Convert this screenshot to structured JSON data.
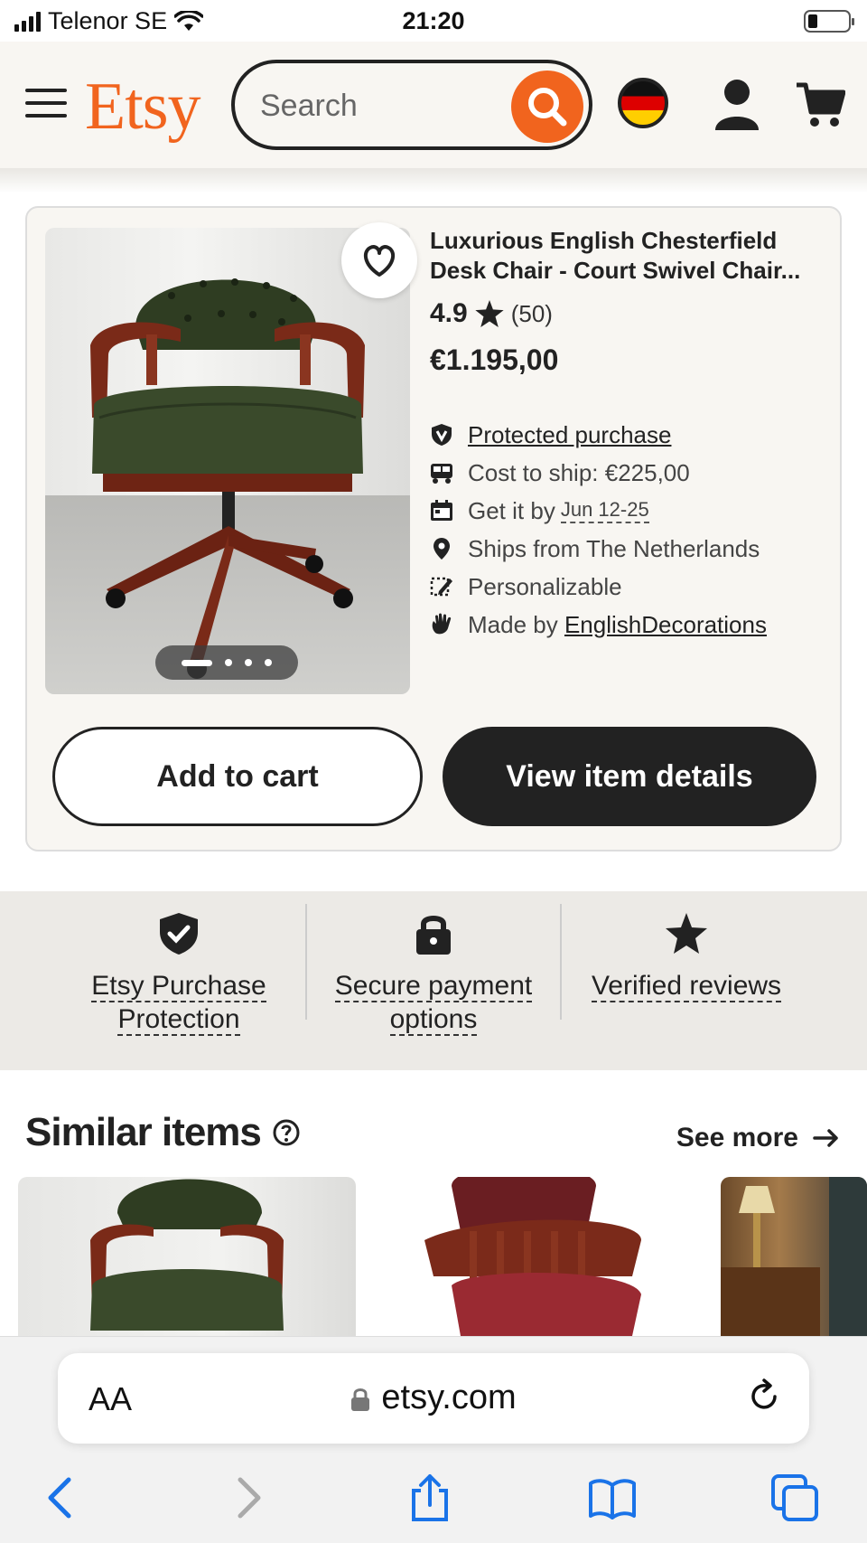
{
  "status_bar": {
    "carrier": "Telenor SE",
    "time": "21:20"
  },
  "header": {
    "logo": "Etsy",
    "search_placeholder": "Search"
  },
  "product": {
    "title_line1": "Luxurious English Chesterfield",
    "title_line2": "Desk Chair - Court Swivel Chair...",
    "rating": "4.9",
    "review_count": "(50)",
    "price": "€1.195,00",
    "features": {
      "protected": "Protected purchase",
      "ship": "Cost to ship: €225,00",
      "get_by_prefix": "Get it by",
      "get_by_date": "Jun 12-25",
      "ships_from": "Ships from The Netherlands",
      "personalizable": "Personalizable",
      "made_by_prefix": "Made by",
      "made_by_shop": "EnglishDecorations"
    },
    "image_count": 4,
    "image_active_index": 1
  },
  "actions": {
    "add_to_cart": "Add to cart",
    "view_details": "View item details"
  },
  "trust": {
    "purchase_line1": "Etsy Purchase",
    "purchase_line2": "Protection",
    "payment_line1": "Secure payment",
    "payment_line2": "options",
    "reviews": "Verified reviews"
  },
  "similar": {
    "title": "Similar items",
    "see_more": "See more"
  },
  "safari": {
    "text_size": "AA",
    "url": "etsy.com"
  },
  "colors": {
    "brand": "#f1641e",
    "dark": "#222222",
    "background": "#f8f6f2"
  }
}
